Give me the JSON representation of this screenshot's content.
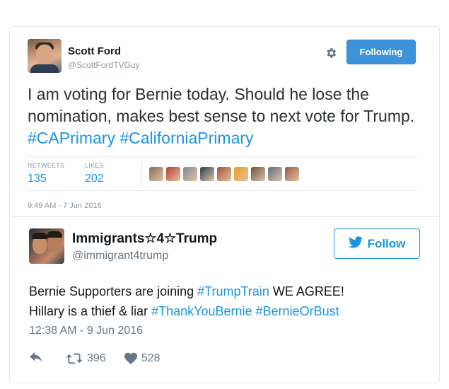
{
  "tweet1": {
    "name": "Scott Ford",
    "handle": "@ScottFordTVGuy",
    "follow_label": "Following",
    "text_plain": "I am voting for Bernie today. Should he lose the nomination, makes best sense to next vote for Trump. ",
    "hashtags": [
      "#CAPrimary",
      "#CaliforniaPrimary"
    ],
    "stats": [
      {
        "label": "RETWEETS",
        "value": "135"
      },
      {
        "label": "LIKES",
        "value": "202"
      }
    ],
    "likers_colors": [
      "#8a6a55",
      "#c0392b",
      "#7f8c8d",
      "#2c3e50",
      "#a0522d",
      "#f39c12",
      "#6b4f3a",
      "#5d6d7e",
      "#9b5a3c"
    ],
    "timestamp": "9:49 AM - 7 Jun 2016"
  },
  "tweet2": {
    "name": "Immigrants☆4☆Trump",
    "handle": "@immigrant4trump",
    "follow_label": "Follow",
    "line1_plain": "Bernie Supporters are joining ",
    "line1_hashtag": "#TrumpTrain",
    "line1_rest": " WE AGREE!",
    "line2_plain": "Hillary is a thief & liar ",
    "line2_hashtags": [
      "#ThankYouBernie",
      "#BernieOrBust"
    ],
    "timestamp": "12:38 AM - 9 Jun 2016",
    "retweets": "396",
    "likes": "528"
  },
  "icons": {
    "gear": "gear-icon",
    "twitter_bird": "twitter-bird-icon",
    "reply": "reply-icon",
    "retweet": "retweet-icon",
    "heart": "heart-icon"
  },
  "colors": {
    "brand_blue": "#1b95e0",
    "following_bg": "#3b94d9",
    "muted": "#8899a6"
  }
}
